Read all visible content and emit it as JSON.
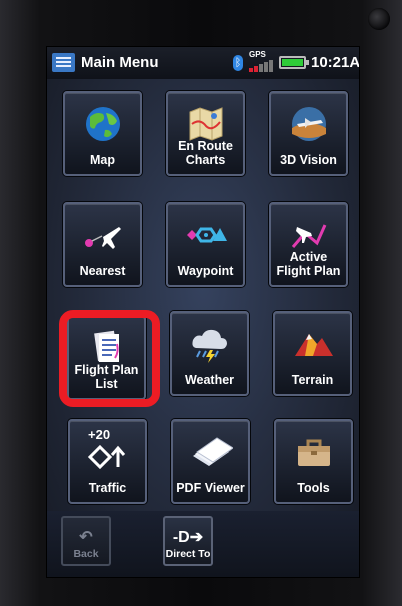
{
  "header": {
    "title": "Main Menu",
    "gps_label": "GPS",
    "time": "10:21A",
    "battery_level": 1.0
  },
  "menu": [
    {
      "label": "Map",
      "icon": "globe-icon"
    },
    {
      "label": "En Route\nCharts",
      "icon": "map-icon"
    },
    {
      "label": "3D Vision",
      "icon": "aircraft-3d-icon"
    },
    {
      "label": "Nearest",
      "icon": "nearest-airplane-icon"
    },
    {
      "label": "Waypoint",
      "icon": "waypoint-symbols-icon"
    },
    {
      "label": "Active\nFlight Plan",
      "icon": "flight-route-icon"
    },
    {
      "label": "Flight Plan\nList",
      "icon": "document-list-icon"
    },
    {
      "label": "Weather",
      "icon": "storm-cloud-icon"
    },
    {
      "label": "Terrain",
      "icon": "terrain-icon"
    },
    {
      "label": "Traffic",
      "icon": "traffic-icon",
      "badge": "+20"
    },
    {
      "label": "PDF Viewer",
      "icon": "pdf-pages-icon"
    },
    {
      "label": "Tools",
      "icon": "toolbox-icon"
    }
  ],
  "footer": {
    "back_label": "Back",
    "direct_to_label": "Direct To"
  },
  "colors": {
    "highlight": "#ec1c24",
    "battery": "#2fcc38",
    "accent_blue": "#3a78c5"
  }
}
